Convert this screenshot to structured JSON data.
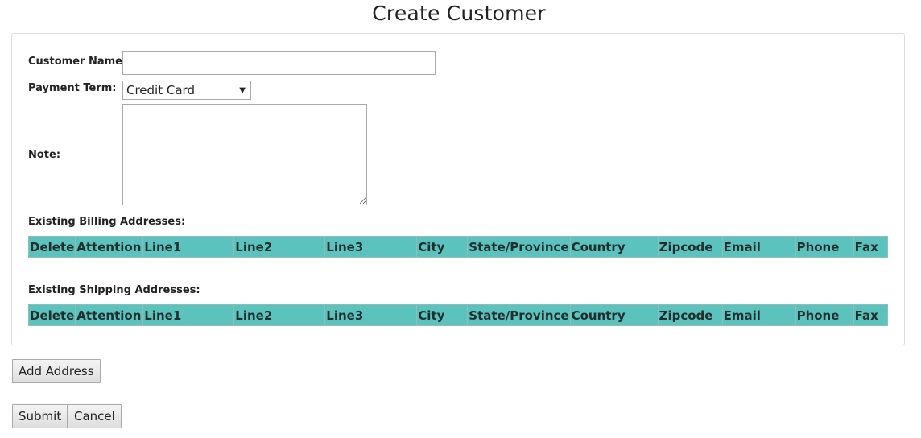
{
  "page": {
    "title": "Create Customer"
  },
  "form": {
    "customer_name_label": "Customer Name:",
    "customer_name_value": "",
    "payment_term_label": "Payment Term:",
    "payment_term_value": "Credit Card",
    "note_label": "Note:",
    "note_value": ""
  },
  "billing": {
    "heading": "Existing Billing Addresses:",
    "columns": [
      "Delete",
      "Attention",
      "Line1",
      "Line2",
      "Line3",
      "City",
      "State/Province",
      "Country",
      "Zipcode",
      "Email",
      "Phone",
      "Fax"
    ]
  },
  "shipping": {
    "heading": "Existing Shipping Addresses:",
    "columns": [
      "Delete",
      "Attention",
      "Line1",
      "Line2",
      "Line3",
      "City",
      "State/Province",
      "Country",
      "Zipcode",
      "Email",
      "Phone",
      "Fax"
    ]
  },
  "actions": {
    "add_address_label": "Add Address",
    "submit_label": "Submit",
    "cancel_label": "Cancel"
  },
  "colors": {
    "table_header_bg": "#5bc2bd"
  }
}
